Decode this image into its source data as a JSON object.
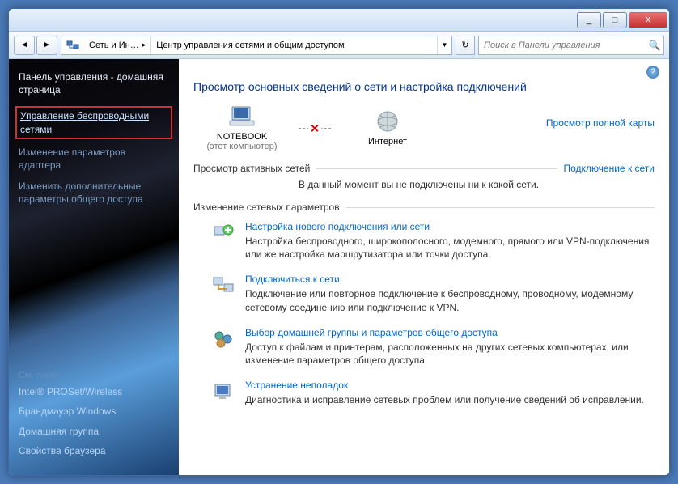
{
  "titlebar": {
    "min": "_",
    "max": "□",
    "close": "X"
  },
  "toolbar": {
    "back": "◄",
    "fwd": "►",
    "crumbs": [
      "Сеть и Ин…",
      "Центр управления сетями и общим доступом"
    ],
    "refresh": "↻",
    "search_ph": "Поиск в Панели управления",
    "search_icon": "🔍"
  },
  "sidebar": {
    "home": "Панель управления - домашняя страница",
    "manage_wireless": "Управление беспроводными сетями",
    "adapter": "Изменение параметров адаптера",
    "advanced": "Изменить дополнительные параметры общего доступа",
    "see_also": "См. также",
    "also": [
      "Intel® PROSet/Wireless",
      "Брандмауэр Windows",
      "Домашняя группа",
      "Свойства браузера"
    ]
  },
  "main": {
    "help": "?",
    "title": "Просмотр основных сведений о сети и настройка подключений",
    "diag": {
      "pc": "NOTEBOOK",
      "pcsub": "(этот компьютер)",
      "x": "✕",
      "net": "Интернет"
    },
    "maplink": "Просмотр полной карты",
    "active": {
      "title": "Просмотр активных сетей",
      "connect": "Подключение к сети",
      "msg": "В данный момент вы не подключены ни к какой сети."
    },
    "change": {
      "title": "Изменение сетевых параметров"
    },
    "items": [
      {
        "link": "Настройка нового подключения или сети",
        "desc": "Настройка беспроводного, широкополосного, модемного, прямого или VPN-подключения или же настройка маршрутизатора или точки доступа."
      },
      {
        "link": "Подключиться к сети",
        "desc": "Подключение или повторное подключение к беспроводному, проводному, модемному сетевому соединению или подключение к VPN."
      },
      {
        "link": "Выбор домашней группы и параметров общего доступа",
        "desc": "Доступ к файлам и принтерам, расположенных на других сетевых компьютерах, или изменение параметров общего доступа."
      },
      {
        "link": "Устранение неполадок",
        "desc": "Диагностика и исправление сетевых проблем или получение сведений об исправлении."
      }
    ]
  }
}
